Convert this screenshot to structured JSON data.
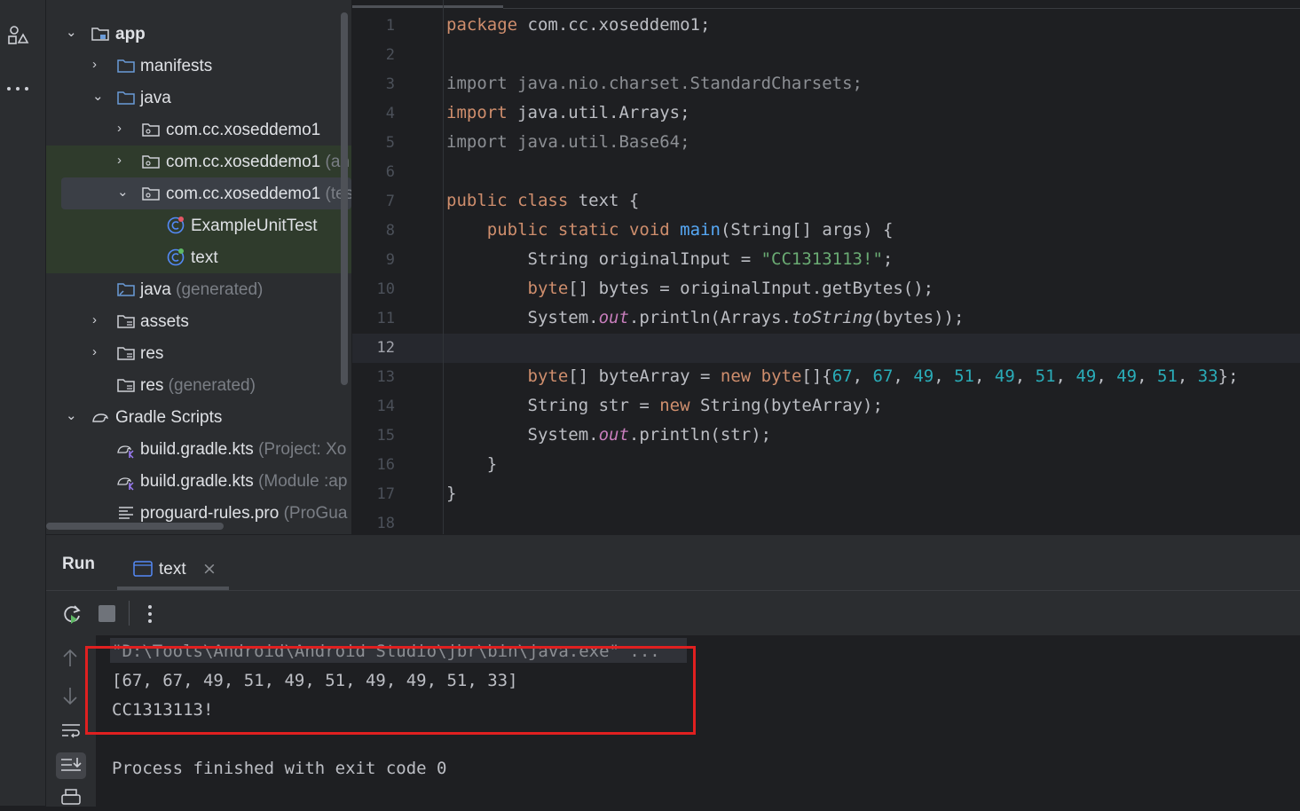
{
  "toolstrip": {
    "icons": [
      "structure-icon",
      "more-icon"
    ]
  },
  "project_tree": {
    "items": [
      {
        "label": "app",
        "suffix": ""
      },
      {
        "label": "manifests",
        "suffix": ""
      },
      {
        "label": "java",
        "suffix": ""
      },
      {
        "label": "com.cc.xoseddemo1",
        "suffix": ""
      },
      {
        "label": "com.cc.xoseddemo1",
        "suffix": " (an"
      },
      {
        "label": "com.cc.xoseddemo1",
        "suffix": " (tes"
      },
      {
        "label": "ExampleUnitTest",
        "suffix": ""
      },
      {
        "label": "text",
        "suffix": ""
      },
      {
        "label": "java",
        "suffix": " (generated)"
      },
      {
        "label": "assets",
        "suffix": ""
      },
      {
        "label": "res",
        "suffix": ""
      },
      {
        "label": "res",
        "suffix": " (generated)"
      },
      {
        "label": "Gradle Scripts",
        "suffix": ""
      },
      {
        "label": "build.gradle.kts",
        "suffix": " (Project: Xo"
      },
      {
        "label": "build.gradle.kts",
        "suffix": " (Module :ap"
      },
      {
        "label": "proguard-rules.pro",
        "suffix": " (ProGua"
      }
    ]
  },
  "editor": {
    "current_line": 12,
    "line_numbers": [
      "1",
      "2",
      "3",
      "4",
      "5",
      "6",
      "7",
      "8",
      "9",
      "10",
      "11",
      "12",
      "13",
      "14",
      "15",
      "16",
      "17",
      "18"
    ],
    "lines": [
      "package com.cc.xoseddemo1;",
      "",
      "import java.nio.charset.StandardCharsets;",
      "import java.util.Arrays;",
      "import java.util.Base64;",
      "",
      "public class text {",
      "    public static void main(String[] args) {",
      "        String originalInput = \"CC1313113!\";",
      "        byte[] bytes = originalInput.getBytes();",
      "        System.out.println(Arrays.toString(bytes));",
      "",
      "        byte[] byteArray = new byte[]{67, 67, 49, 51, 49, 51, 49, 49, 51, 33};",
      "        String str = new String(byteArray);",
      "        System.out.println(str);",
      "    }",
      "}",
      ""
    ]
  },
  "run_panel": {
    "title": "Run",
    "tab_label": "text",
    "close_glyph": "×",
    "console": {
      "command": "\"D:\\Tools\\Android\\Android Studio\\jbr\\bin\\java.exe\" ...",
      "output_1": "[67, 67, 49, 51, 49, 51, 49, 49, 51, 33]",
      "output_2": "CC1313113!",
      "exit": "Process finished with exit code 0"
    }
  },
  "colors": {
    "keyword": "#cf8e6d",
    "string": "#6aab73",
    "number": "#2aacb8",
    "field": "#c77dbb",
    "method": "#56a8f5",
    "highlight_box": "#e02020"
  }
}
